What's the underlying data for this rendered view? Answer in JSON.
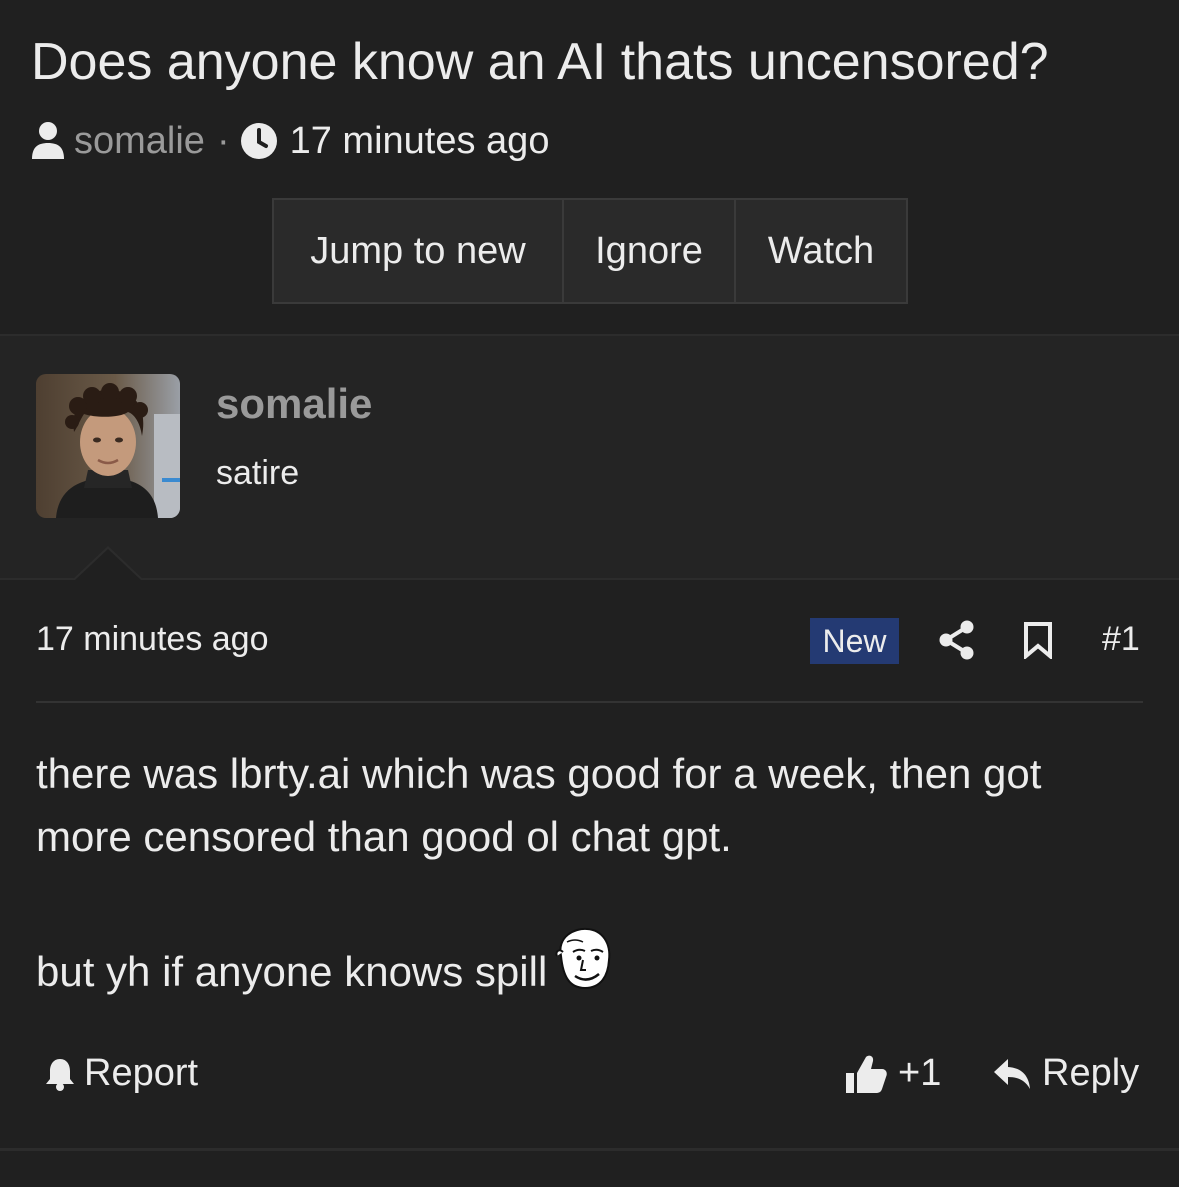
{
  "thread": {
    "title": "Does anyone know an AI thats uncensored?",
    "author": "somalie",
    "separator": "·",
    "time": "17 minutes ago"
  },
  "actions": {
    "jump_label": "Jump to new",
    "ignore_label": "Ignore",
    "watch_label": "Watch"
  },
  "user": {
    "name": "somalie",
    "title": "satire"
  },
  "post": {
    "time": "17 minutes ago",
    "badge": "New",
    "number": "#1",
    "paragraph1": "there was lbrty.ai which was good for a week, then got more censored than good ol chat gpt.",
    "paragraph2": "but yh if anyone knows spill"
  },
  "footer": {
    "report_label": "Report",
    "likes": "+1",
    "reply_label": "Reply"
  },
  "colors": {
    "background": "#202020",
    "user_block": "#242424",
    "badge": "#243a73",
    "muted_text": "#9a9a9a"
  },
  "icons": [
    "user-icon",
    "clock-icon",
    "share-icon",
    "bookmark-icon",
    "bell-icon",
    "thumbs-up-icon",
    "reply-icon",
    "wojak-emoji"
  ]
}
